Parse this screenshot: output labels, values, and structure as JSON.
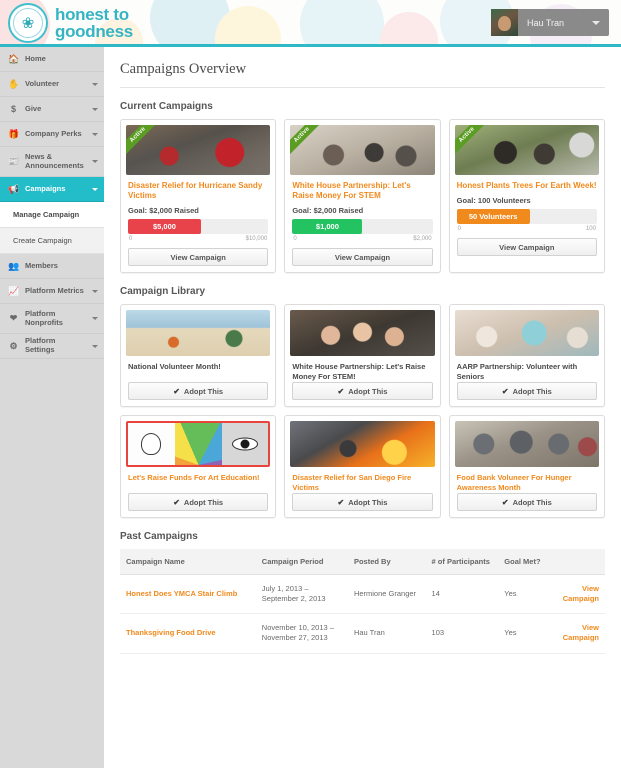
{
  "header": {
    "brand_line1": "honest to",
    "brand_line2": "goodness",
    "logo_icon": "butterfly-logo-icon",
    "user_name": "Hau Tran",
    "caret_icon": "chevron-down-icon",
    "accent_color": "#2fb8c6"
  },
  "sidebar": {
    "items": [
      {
        "label": "Home",
        "icon": "home-icon",
        "has_arrow": false,
        "active": false
      },
      {
        "label": "Volunteer",
        "icon": "hand-icon",
        "has_arrow": true,
        "active": false
      },
      {
        "label": "Give",
        "icon": "dollar-icon",
        "has_arrow": true,
        "active": false
      },
      {
        "label": "Company Perks",
        "icon": "gift-icon",
        "has_arrow": true,
        "active": false
      },
      {
        "label": "News & Announcements",
        "icon": "news-icon",
        "has_arrow": true,
        "active": false
      },
      {
        "label": "Campaigns",
        "icon": "megaphone-icon",
        "has_arrow": true,
        "active": true
      },
      {
        "label": "Members",
        "icon": "members-icon",
        "has_arrow": false,
        "active": false
      },
      {
        "label": "Platform Metrics",
        "icon": "chart-icon",
        "has_arrow": true,
        "active": false
      },
      {
        "label": "Platform Nonprofits",
        "icon": "heart-icon",
        "has_arrow": true,
        "active": false
      },
      {
        "label": "Platform Settings",
        "icon": "gear-icon",
        "has_arrow": true,
        "active": false
      }
    ],
    "sub_items": [
      {
        "label": "Manage Campaign",
        "current": true
      },
      {
        "label": "Create Campaign",
        "current": false
      }
    ],
    "active_color": "#23bdc9"
  },
  "main": {
    "page_title": "Campaigns Overview",
    "sections": {
      "current": "Current Campaigns",
      "library": "Campaign Library",
      "past": "Past Campaigns"
    }
  },
  "current_campaigns": [
    {
      "badge": "Active",
      "title": "Disaster Relief for Hurricane Sandy Victims",
      "goal_label": "Goal: $2,000 Raised",
      "bar_value_label": "$5,000",
      "bar_color": "#e8434a",
      "bar_percent": 52,
      "scale_min": "0",
      "scale_max": "$10,000",
      "button": "View Campaign"
    },
    {
      "badge": "Active",
      "title": "White House Partnership: Let's Raise Money For STEM",
      "goal_label": "Goal: $2,000 Raised",
      "bar_value_label": "$1,000",
      "bar_color": "#22c360",
      "bar_percent": 50,
      "scale_min": "0",
      "scale_max": "$2,000",
      "button": "View Campaign"
    },
    {
      "badge": "Active",
      "title": "Honest Plants Trees For Earth Week!",
      "goal_label": "Goal: 100 Volunteers",
      "bar_value_label": "50 Volunteers",
      "bar_color": "#f18a1c",
      "bar_percent": 52,
      "scale_min": "0",
      "scale_max": "100",
      "button": "View Campaign"
    }
  ],
  "campaign_library": [
    {
      "title": "National Volunteer Month!",
      "title_color": "dark",
      "button": "Adopt This",
      "check_icon": "check-icon"
    },
    {
      "title": "White House Partnership: Let's Raise Money For STEM!",
      "title_color": "dark",
      "button": "Adopt This",
      "check_icon": "check-icon"
    },
    {
      "title": "AARP Partnership: Volunteer with Seniors",
      "title_color": "dark",
      "button": "Adopt This",
      "check_icon": "check-icon"
    },
    {
      "title": "Let's Raise Funds For Art Education!",
      "title_color": "orange",
      "button": "Adopt This",
      "check_icon": "check-icon"
    },
    {
      "title": "Disaster Relief for San Diego Fire Victims",
      "title_color": "orange",
      "button": "Adopt This",
      "check_icon": "check-icon"
    },
    {
      "title": "Food Bank Voluneer For Hunger Awareness Month",
      "title_color": "orange",
      "button": "Adopt This",
      "check_icon": "check-icon"
    }
  ],
  "past_campaigns": {
    "columns": [
      "Campaign Name",
      "Campaign Period",
      "Posted By",
      "# of Participants",
      "Goal Met?",
      ""
    ],
    "rows": [
      {
        "name": "Honest Does YMCA Stair Climb",
        "period": "July 1, 2013 – September 2, 2013",
        "posted_by": "Hermione Granger",
        "participants": "14",
        "goal_met": "Yes",
        "action": "View Campaign"
      },
      {
        "name": "Thanksgiving Food Drive",
        "period": "November 10, 2013 – November 27, 2013",
        "posted_by": "Hau Tran",
        "participants": "103",
        "goal_met": "Yes",
        "action": "View Campaign"
      }
    ]
  }
}
